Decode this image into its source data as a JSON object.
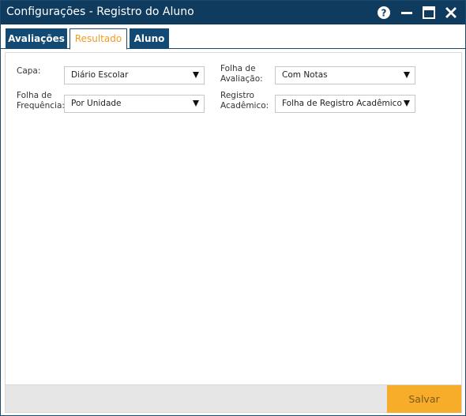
{
  "window": {
    "title": "Configurações - Registro do Aluno",
    "colors": {
      "titlebar": "#0f3b5f",
      "accent": "#f29c1f",
      "save": "#f8ad2a"
    }
  },
  "controls": {
    "help_icon": "help-circle",
    "minimize_icon": "minus",
    "maximize_icon": "window",
    "close_icon": "x"
  },
  "tabs": [
    {
      "label": "Avaliações",
      "active": false
    },
    {
      "label": "Resultado",
      "active": true
    },
    {
      "label": "Aluno",
      "active": false
    }
  ],
  "form": {
    "capa": {
      "label": "Capa:",
      "value": "Diário Escolar"
    },
    "folha_avaliacao": {
      "label": "Folha de\nAvaliação:",
      "value": "Com Notas"
    },
    "folha_frequencia": {
      "label": "Folha de\nFrequência:",
      "value": "Por Unidade"
    },
    "registro_academico": {
      "label": "Registro\nAcadêmico:",
      "value": "Folha de Registro Acadêmico"
    }
  },
  "footer": {
    "save_label": "Salvar"
  }
}
